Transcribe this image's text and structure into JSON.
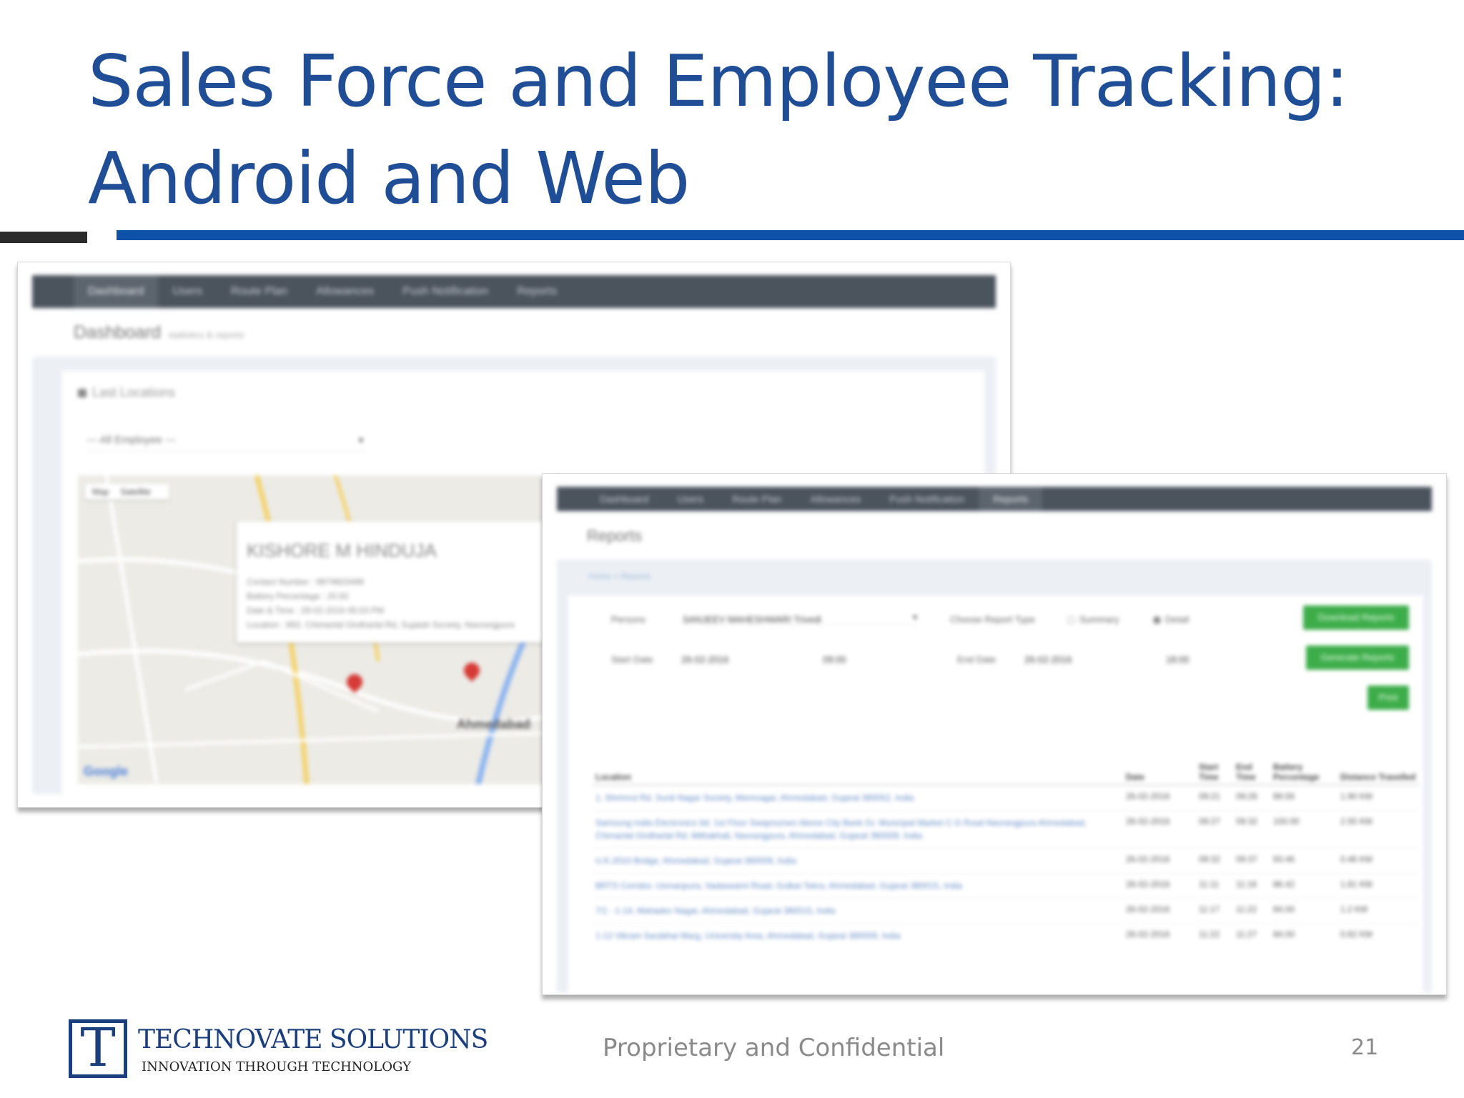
{
  "slide": {
    "title_line1": "Sales Force and Employee Tracking:",
    "title_line2": "Android and Web",
    "footer_brand": "TECHNOVATE SOLUTIONS",
    "footer_tagline": "INNOVATION THROUGH TECHNOLOGY",
    "footer_logo_letter": "T",
    "footer_center": "Proprietary and Confidential",
    "page_number": "21",
    "colors": {
      "title": "#1f4e96",
      "rule_blue": "#0e51a8",
      "rule_dark": "#2b2b2b",
      "brand": "#1b3f7c"
    }
  },
  "dashboard": {
    "nav": [
      "Dashboard",
      "Users",
      "Route Plan",
      "Allowances",
      "Push Notification",
      "Reports"
    ],
    "active_nav": "Dashboard",
    "page_title": "Dashboard",
    "page_subtitle": "statistics & reports",
    "panel_title": "Last Locations",
    "employee_select": "--- All Employee ---",
    "map": {
      "buttons": [
        "Map",
        "Satellite"
      ],
      "info_name": "KISHORE M HINDUJA",
      "info_lines": [
        "Contact Number : 9979603499",
        "Battery Percentage : 20.92",
        "Date & Time : 26-02-2016 05:03 PM",
        "Location : 892, Chimanlal Girdharlal Rd, Sujatah Society, Navrangpura"
      ],
      "city_label": "Ahmedabad",
      "attribution": "Google"
    }
  },
  "reports": {
    "nav": [
      "Dashboard",
      "Users",
      "Route Plan",
      "Allowances",
      "Push Notification",
      "Reports"
    ],
    "active_nav": "Reports",
    "page_title": "Reports",
    "breadcrumb": "Home > Reports",
    "person_label": "Persons",
    "person_value": "SANJEEV MAHESHWARI Trivedi",
    "report_type_label": "Choose Report Type",
    "report_type_options": [
      "Summary",
      "Detail"
    ],
    "report_type_selected": "Detail",
    "start_date_label": "Start Date",
    "start_date": "26-02-2016",
    "start_time": "09:00",
    "end_date_label": "End Date",
    "end_date": "26-02-2016",
    "end_time": "18:00",
    "buttons": {
      "download": "Download Reports",
      "generate": "Generate Reports",
      "print": "Print"
    },
    "table": {
      "columns": [
        "Location",
        "Date",
        "Start Time",
        "End Time",
        "Battery Percentage",
        "Distance Travelled"
      ],
      "rows": [
        [
          "1, Shrimrut Rd, Sunit Nagar Society, Memnagar, Ahmedabad, Gujarat 380052, India",
          "26-02-2016",
          "09:21",
          "09:26",
          "89.56",
          "1.90 KM"
        ],
        [
          "Samsung India Electronics Itd. 1st Floor Swapnumen Above City Bank Gr, Municipal Market C G Road Navrangpura Ahmedabad, Chimanlal Girdharlal Rd, Mithakhali, Navrangpura, Ahmedabad, Gujarat 380009, India",
          "26-02-2016",
          "09:27",
          "09:32",
          "100.00",
          "2.55 KM"
        ],
        [
          "U.K.2010 Bridge, Ahmedabad, Gujarat 380009, India",
          "26-02-2016",
          "09:32",
          "09:37",
          "93.46",
          "0.46 KM"
        ],
        [
          "BRTS Corridor, Usmanpura, Vadaswami Road, Gulbai Tekra, Ahmedabad, Gujarat 380015, India",
          "26-02-2016",
          "11:11",
          "11:16",
          "86.42",
          "1.81 KM"
        ],
        [
          "7/1 - 1-14, Mahadev Nagar, Ahmedabad, Gujarat 380015, India",
          "26-02-2016",
          "11:17",
          "11:22",
          "84.00",
          "1.2 KM"
        ],
        [
          "1-12 Vikram Sarabhai Marg, University Area, Ahmedabad, Gujarat 380009, India",
          "26-02-2016",
          "11:22",
          "11:27",
          "84.00",
          "0.62 KM"
        ]
      ]
    }
  }
}
